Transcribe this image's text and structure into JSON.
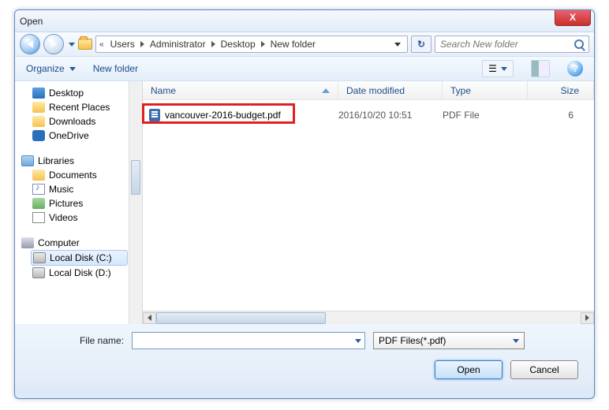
{
  "title": "Open",
  "breadcrumb": {
    "b0": "Users",
    "b1": "Administrator",
    "b2": "Desktop",
    "b3": "New folder"
  },
  "search": {
    "placeholder": "Search New folder"
  },
  "toolbar": {
    "organize": "Organize",
    "newfolder": "New folder"
  },
  "tree": {
    "desktop": "Desktop",
    "recent": "Recent Places",
    "downloads": "Downloads",
    "onedrive": "OneDrive",
    "libraries": "Libraries",
    "documents": "Documents",
    "music": "Music",
    "pictures": "Pictures",
    "videos": "Videos",
    "computer": "Computer",
    "diskc": "Local Disk (C:)",
    "diskd": "Local Disk (D:)"
  },
  "columns": {
    "name": "Name",
    "date": "Date modified",
    "type": "Type",
    "size": "Size"
  },
  "files": {
    "f0": {
      "name": "vancouver-2016-budget.pdf",
      "date": "2016/10/20 10:51",
      "type": "PDF File",
      "size": "6"
    }
  },
  "footer": {
    "filelabel": "File name:",
    "filename": "",
    "filter": "PDF Files(*.pdf)",
    "open": "Open",
    "cancel": "Cancel"
  }
}
